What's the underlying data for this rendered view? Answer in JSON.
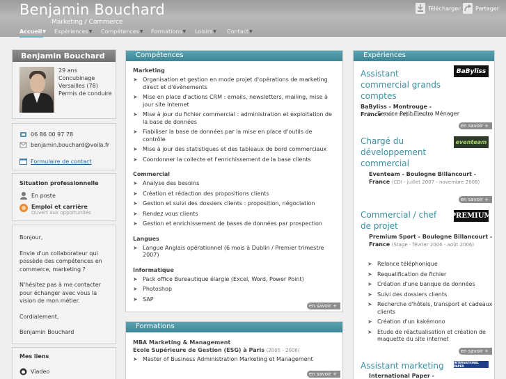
{
  "header": {
    "name": "Benjamin Bouchard",
    "subtitle": "Marketing / Commerce",
    "download_label": "Télécharger",
    "share_label": "Partager",
    "download_icon": "download-icon",
    "share_icon": "share-icon"
  },
  "nav": {
    "items": [
      {
        "label": "Accueil",
        "active": true
      },
      {
        "label": "Expériences"
      },
      {
        "label": "Compétences"
      },
      {
        "label": "Formations"
      },
      {
        "label": "Loisirs"
      },
      {
        "label": "Contact"
      }
    ]
  },
  "profile": {
    "name": "Benjamin Bouchard",
    "age": "29 ans",
    "status": "Concubinage",
    "city": "Versailles (78)",
    "license": "Permis de conduire",
    "phone": "06 86 00 97 78",
    "email": "benjamin.bouchard@voila.fr",
    "contact_form": "Formulaire de contact"
  },
  "situation": {
    "title": "Situation professionnelle",
    "status": "En poste",
    "job_title": "Emploi et carrière",
    "job_sub": "Ouvert aux opportunités"
  },
  "message": {
    "greeting": "Bonjour,",
    "p1": "Envie d'un collaborateur qui possède des compétences en commerce, marketing ?",
    "p2": "N'hésitez pas à me contacter pour échanger avec vous la vision de mon métier.",
    "closing": "Cordialement,",
    "signature": "Benjamin Bouchard"
  },
  "links": {
    "title": "Mes liens",
    "items": [
      "Viadeo"
    ]
  },
  "competences": {
    "title": "Compétences",
    "more": "en savoir +",
    "categories": [
      {
        "name": "Marketing",
        "items": [
          "Organisation et gestion en mode projet d'opérations de marketing direct et d'évènements",
          "Mise en place d'actions CRM : emails, newsletters, mailing, mise à jour site Internet",
          "Mise à jour du fichier commercial : administration et exploitation de la base de données",
          "Fiabiliser la base de données par la mise en place d'outils de contrôle",
          "Mise à jour des statistiques et des tableaux de bord commerciaux",
          "Coordonner la collecte et l'enrichissement de la base clients"
        ]
      },
      {
        "name": "Commercial",
        "items": [
          "Analyse des besoins",
          "Création et rédaction des propositions clients",
          "Gestion et suivi des dossiers clients : proposition, négociation",
          "Rendez vous clients",
          "Gestion et enrichissement de bases de données par prospection"
        ]
      },
      {
        "name": "Langues",
        "items": [
          "Langue Anglais opérationnel (6 mois à Dublin / Premier trimestre 2007)"
        ]
      },
      {
        "name": "Informatique",
        "items": [
          "Pack office Bureautique élargie (Excel, Word, Power Point)",
          "Photoshop",
          "SAP"
        ]
      }
    ]
  },
  "formations": {
    "title": "Formations",
    "degree": "MBA Marketing & Management",
    "school": "Ecole Supérieure de Gestion (ESG) à Paris",
    "years": "(2005 - 2006)",
    "item": "Master of Business Administration Marketing et Management",
    "more": "en savoir +"
  },
  "experiences": {
    "title": "Expériences",
    "more": "en savoir +",
    "items": [
      {
        "title": "Assistant commercial grands comptes",
        "company": "BaByliss - Montrouge - France",
        "detail": "(CDI - Depuis 2 ans)",
        "logo": "BaByliss",
        "bullets": [
          "Service Petit Electro Ménager"
        ]
      },
      {
        "title": "Chargé du développement commercial",
        "company": "Eventeam - Boulogne Billancourt - France",
        "detail": "(CDI - juillet 2007 - novembre 2008)",
        "logo": "eventeam",
        "bullets": []
      },
      {
        "title": "Commercial / chef de projet",
        "company": "Premium Sport - Boulogne Billancourt - France",
        "detail": "(Stage - février 2006 - août 2006)",
        "logo": "PREMIUM",
        "bullets": [
          "Relance téléphonique",
          "Requalification de fichier",
          "Création d'une banque de données",
          "Suivi des dossiers clients",
          "Recherche d'hôtels, transport et cadeaux clients",
          "Création d'un kakémono",
          "Etude de réactualisation et création de maquette du site internet"
        ]
      },
      {
        "title": "Assistant marketing",
        "company": "International Paper -",
        "detail": "",
        "logo": "INTERNATIONAL PAPER",
        "bullets": []
      }
    ]
  }
}
